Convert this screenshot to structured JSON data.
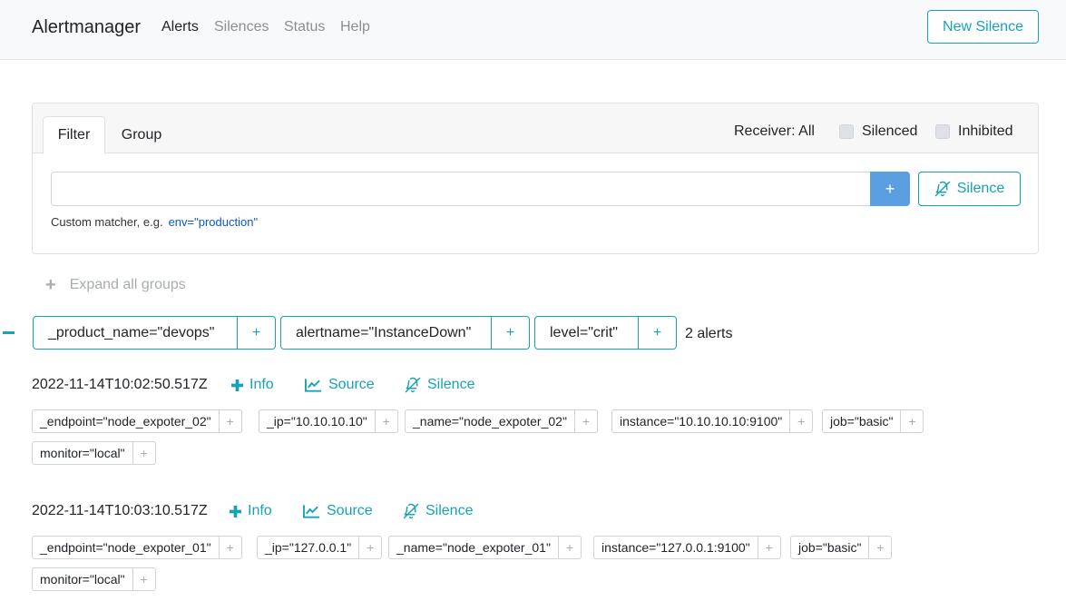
{
  "navbar": {
    "brand": "Alertmanager",
    "links": [
      {
        "label": "Alerts",
        "active": true
      },
      {
        "label": "Silences",
        "active": false
      },
      {
        "label": "Status",
        "active": false
      },
      {
        "label": "Help",
        "active": false
      }
    ],
    "new_silence_label": "New Silence"
  },
  "filter": {
    "tabs": [
      {
        "label": "Filter",
        "active": true
      },
      {
        "label": "Group",
        "active": false
      }
    ],
    "receiver": "Receiver: All",
    "silenced_label": "Silenced",
    "inhibited_label": "Inhibited",
    "input_value": "",
    "add_label": "+",
    "silence_label": "Silence",
    "hint_text": "Custom matcher, e.g.",
    "hint_example": "env=\"production\""
  },
  "expand_all": {
    "icon": "plus-icon",
    "label": "Expand all groups"
  },
  "group": {
    "labels": [
      "_product_name=\"devops\"",
      "alertname=\"InstanceDown\"",
      "level=\"crit\""
    ],
    "plus": "+",
    "count": "2 alerts"
  },
  "alerts": [
    {
      "timestamp": "2022-11-14T10:02:50.517Z",
      "info_label": "Info",
      "source_label": "Source",
      "silence_label": "Silence",
      "labels": [
        "_endpoint=\"node_expoter_02\"",
        "_ip=\"10.10.10.10\"",
        "_name=\"node_expoter_02\"",
        "instance=\"10.10.10.10:9100\"",
        "job=\"basic\"",
        "monitor=\"local\""
      ]
    },
    {
      "timestamp": "2022-11-14T10:03:10.517Z",
      "info_label": "Info",
      "source_label": "Source",
      "silence_label": "Silence",
      "labels": [
        "_endpoint=\"node_expoter_01\"",
        "_ip=\"127.0.0.1\"",
        "_name=\"node_expoter_01\"",
        "instance=\"127.0.0.1:9100\"",
        "job=\"basic\"",
        "monitor=\"local\""
      ]
    }
  ],
  "colors": {
    "accent": "#17a2b8",
    "primary": "#5a9fe0",
    "link": "#0a58ca"
  }
}
